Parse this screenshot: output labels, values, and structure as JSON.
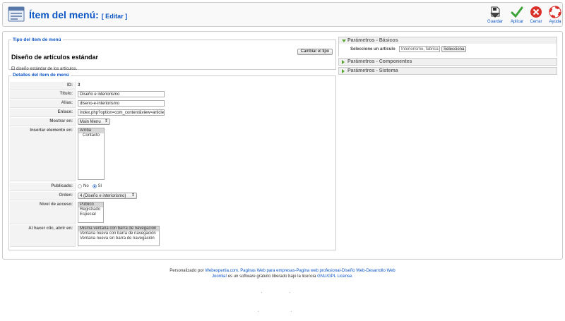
{
  "header": {
    "title": "Ítem del menú:",
    "subtitle": "[ Editar ]",
    "toolbar": [
      {
        "label": "Guardar",
        "icon": "save-icon"
      },
      {
        "label": "Aplicar",
        "icon": "apply-icon"
      },
      {
        "label": "Cerrar",
        "icon": "close-icon"
      },
      {
        "label": "Ayuda",
        "icon": "help-icon"
      }
    ]
  },
  "tipo": {
    "legend": "Tipo del ítem de menú",
    "title": "Diseño de artículos estándar",
    "description": "El diseño estándar de los artículos.",
    "change_button": "Cambiar el tipo"
  },
  "details": {
    "legend": "Detalles del ítem de menú",
    "id_label": "ID:",
    "id_value": "3",
    "title_label": "Título:",
    "title_value": "Diseño e interiorismo",
    "alias_label": "Alias:",
    "alias_value": "diseno-e-interiorismo",
    "link_label": "Enlace:",
    "link_value": "index.php?option=com_content&view=article",
    "show_label": "Mostrar en:",
    "show_value": "Main Menu",
    "insert_label": "Insertar elemento en:",
    "insert_options": [
      "Arriba",
      "Contacto"
    ],
    "published_label": "Publicado:",
    "published_no": "No",
    "published_yes": "Sí",
    "order_label": "Orden:",
    "order_value": "4 (Diseño e interiorismo)",
    "access_label": "Nivel de acceso:",
    "access_options": [
      "Público",
      "Registrado",
      "Especial"
    ],
    "click_label": "Al hacer clic, abrir en:",
    "click_options": [
      "Misma ventana con barra de navegación",
      "Ventana nueva con barra de navegación",
      "Ventana nueva sin barra de navegación"
    ]
  },
  "params": {
    "basic": "Parámetros - Básicos",
    "select_article_label": "Seleccione un artículo",
    "select_article_value": "Interiorismo, fabrica",
    "select_button": "Selecciona",
    "components": "Parámetros - Componentes",
    "system": "Parámetros - Sistema"
  },
  "footer": {
    "line1_prefix": "Personalizado por",
    "line1_link": "Webexpertia.com. Paginas Web para empresas-Pagina web profesional-Diseño Web-Desarrollo Web",
    "line2_link1": "Joomla!",
    "line2_text": "es un software gratuito liberado bajo la licencia",
    "line2_link2": "GNU/GPL License."
  },
  "colors": {
    "accent": "#0B55C4",
    "panel_arrow": "#5aa532",
    "close_red": "#d9302a",
    "apply_green": "#3fa33b"
  }
}
